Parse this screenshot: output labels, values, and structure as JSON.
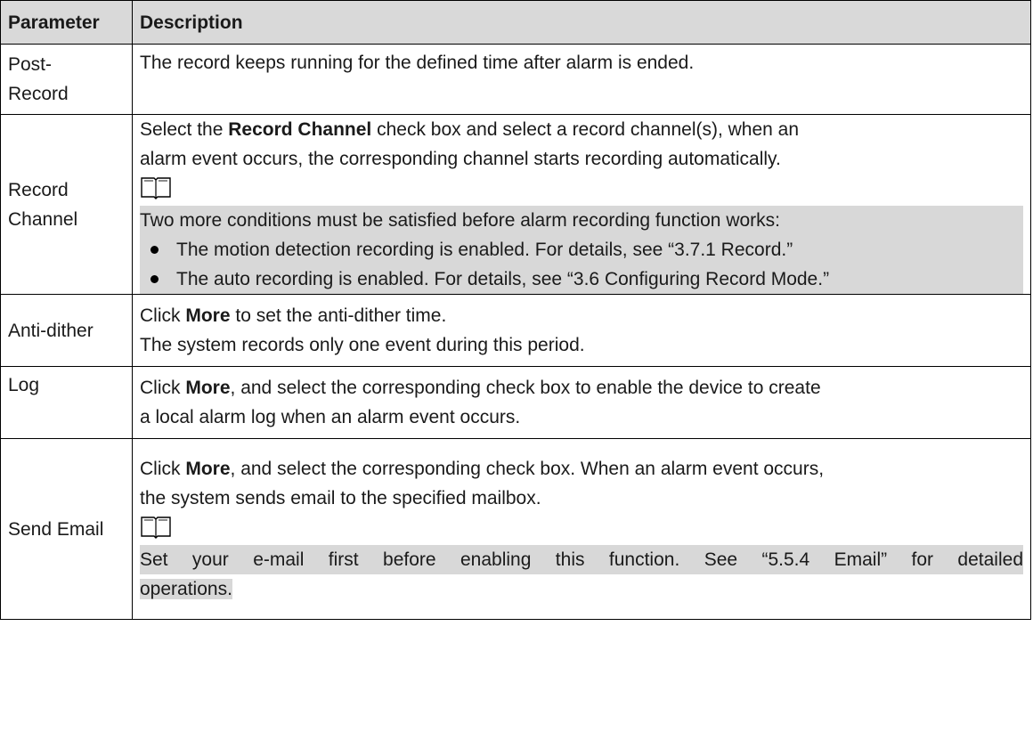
{
  "table": {
    "headers": {
      "parameter": "Parameter",
      "description": "Description"
    },
    "rows": [
      {
        "parameter_lines": [
          "Post-",
          "Record"
        ],
        "description": "The record keeps running for the defined time after alarm is ended."
      },
      {
        "parameter_lines": [
          "Record",
          "Channel"
        ],
        "desc_line1_prefix": "Select the ",
        "desc_line1_bold": "Record Channel",
        "desc_line1_suffix": " check box and select a record channel(s), when an",
        "desc_line2": "alarm event occurs, the corresponding channel starts recording automatically.",
        "note_icon": "book-note-icon",
        "note_text": "Two more conditions must be satisfied before alarm recording function works:",
        "bullets": [
          "The motion detection recording is enabled. For details, see “3.7.1 Record.”",
          "The auto recording is enabled. For details, see “3.6 Configuring Record Mode.”"
        ]
      },
      {
        "parameter": "Anti-dither",
        "desc_line1_prefix": "Click ",
        "desc_line1_bold": "More",
        "desc_line1_suffix": " to set the anti-dither time.",
        "desc_line2": "The system records only one event during this period."
      },
      {
        "parameter": "Log",
        "desc_line1_prefix": "Click ",
        "desc_line1_bold": "More",
        "desc_line1_suffix": ", and select the corresponding check box to enable the device to create",
        "desc_line2": "a local alarm log when an alarm event occurs."
      },
      {
        "parameter": "Send Email",
        "desc_line1_prefix": "Click ",
        "desc_line1_bold": "More",
        "desc_line1_suffix": ", and select the corresponding check box. When an alarm event occurs,",
        "desc_line2": "the system sends email to the specified mailbox.",
        "note_icon": "book-note-icon",
        "note_line1": "Set your e-mail first before enabling this function. See “5.5.4 Email” for detailed",
        "note_line2": "operations."
      }
    ]
  }
}
